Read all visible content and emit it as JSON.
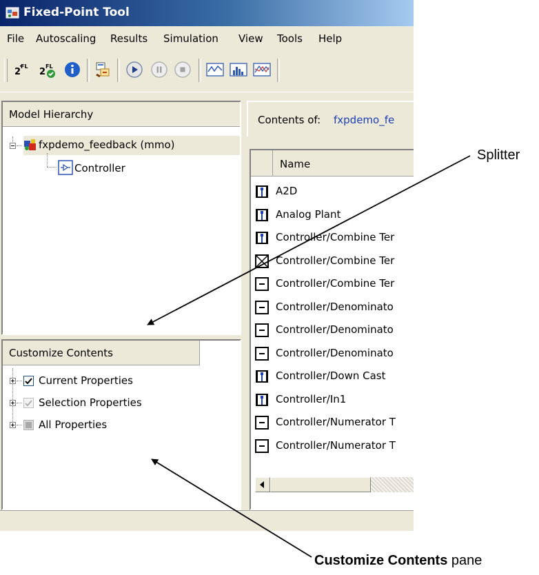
{
  "window": {
    "title": "Fixed-Point Tool",
    "accent": "#0a246a"
  },
  "menu": {
    "items": [
      {
        "label": "File"
      },
      {
        "label": "Autoscaling"
      },
      {
        "label": "Results"
      },
      {
        "label": "Simulation"
      },
      {
        "label": "View"
      },
      {
        "label": "Tools"
      },
      {
        "label": "Help"
      }
    ]
  },
  "toolbar": {
    "fl_label": "FL",
    "exp_label": "2"
  },
  "model_hierarchy": {
    "header": "Model Hierarchy",
    "root": "fxpdemo_feedback (mmo)",
    "child": "Controller"
  },
  "contents": {
    "label": "Contents of:",
    "path": "fxpdemo_fe",
    "column": "Name",
    "rows": [
      {
        "name": "A2D",
        "icon": "signal-logging-icon"
      },
      {
        "name": "Analog Plant",
        "icon": "signal-logging-icon"
      },
      {
        "name": "Controller/Combine Ter",
        "icon": "signal-logging-icon"
      },
      {
        "name": "Controller/Combine Ter",
        "icon": "min-max-icon"
      },
      {
        "name": "Controller/Combine Ter",
        "icon": "overflow-icon"
      },
      {
        "name": "Controller/Denominato",
        "icon": "overflow-icon"
      },
      {
        "name": "Controller/Denominato",
        "icon": "overflow-icon"
      },
      {
        "name": "Controller/Denominato",
        "icon": "overflow-icon"
      },
      {
        "name": "Controller/Down Cast",
        "icon": "signal-logging-icon"
      },
      {
        "name": "Controller/In1",
        "icon": "signal-logging-icon"
      },
      {
        "name": "Controller/Numerator T",
        "icon": "overflow-icon"
      },
      {
        "name": "Controller/Numerator T",
        "icon": "overflow-icon"
      }
    ]
  },
  "customize": {
    "header": "Customize Contents",
    "items": [
      {
        "label": "Current Properties",
        "state": "checked"
      },
      {
        "label": "Selection Properties",
        "state": "checked-disabled"
      },
      {
        "label": "All Properties",
        "state": "indeterminate"
      }
    ]
  },
  "annotations": {
    "splitter": "Splitter",
    "pane_bold": "Customize Contents",
    "pane_rest": " pane"
  }
}
